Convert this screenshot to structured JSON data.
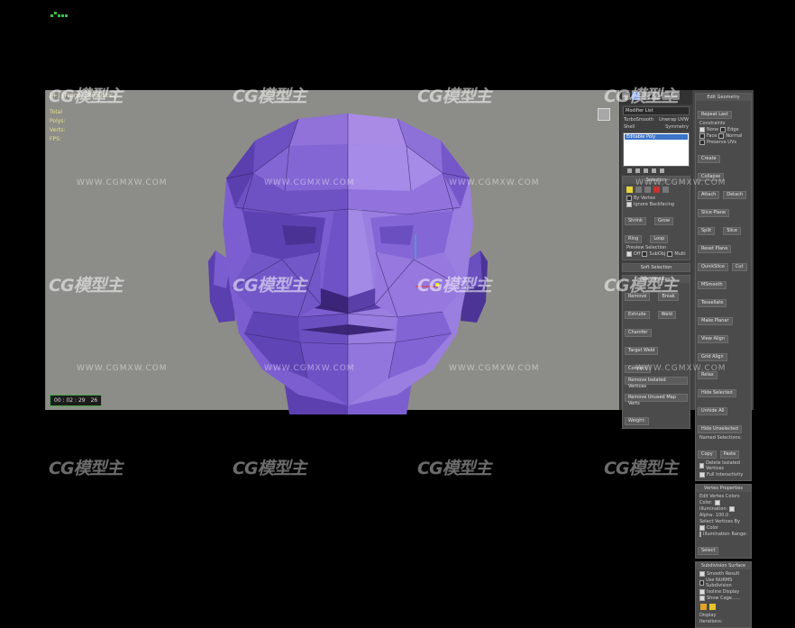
{
  "watermark": {
    "logo_text": "CG模型主",
    "url_text": "WWW.CGMXW.COM"
  },
  "viewport": {
    "label": "[+] [Front] [Realistic]",
    "stats": [
      "Total",
      "Polys:",
      "Verts:",
      "FPS:"
    ],
    "time": [
      "00 : 02 : 29",
      "26"
    ]
  },
  "panel": {
    "modifier_list": "Modifier List",
    "row1": [
      "TurboSmooth",
      "Unwrap UVW"
    ],
    "row2": [
      "Shell",
      "Symmetry"
    ],
    "stack_item": "Editable Poly",
    "selection": {
      "title": "Selection",
      "by_vertex": "By Vertex",
      "ignore_backfacing": "Ignore Backfacing",
      "shrink": "Shrink",
      "grow": "Grow",
      "ring": "Ring",
      "loop": "Loop",
      "preview_selection": "Preview Selection",
      "off": "Off",
      "subobj": "SubObj",
      "multi": "Multi"
    },
    "soft_selection": "Soft Selection",
    "edit_vertices": {
      "title": "Edit Vertices",
      "remove": "Remove",
      "break": "Break",
      "extrude": "Extrude",
      "weld": "Weld",
      "chamfer": "Chamfer",
      "target_weld": "Target Weld",
      "connect": "Connect",
      "remove_isolated": "Remove Isolated Vertices",
      "remove_unused": "Remove Unused Map Verts",
      "weight": "Weight:"
    },
    "edit_geometry": {
      "title": "Edit Geometry",
      "repeat_last": "Repeat Last",
      "constraints": "Constraints",
      "none": "None",
      "edge": "Edge",
      "face": "Face",
      "normal": "Normal",
      "preserve_uvs": "Preserve UVs",
      "create": "Create",
      "collapse": "Collapse",
      "attach": "Attach",
      "detach": "Detach",
      "slice_plane": "Slice Plane",
      "split": "Split",
      "slice": "Slice",
      "reset_plane": "Reset Plane",
      "quickslice": "QuickSlice",
      "cut": "Cut",
      "msmooth": "MSmooth",
      "tessellate": "Tessellate",
      "make_planar": "Make Planar",
      "view_align": "View Align",
      "grid_align": "Grid Align",
      "relax": "Relax",
      "hide_selected": "Hide Selected",
      "unhide_all": "Unhide All",
      "hide_unselected": "Hide Unselected",
      "named_selections": "Named Selections:",
      "copy": "Copy",
      "paste": "Paste",
      "delete_isolated": "Delete Isolated Vertices",
      "full_interactivity": "Full Interactivity"
    },
    "vertex_properties": {
      "title": "Vertex Properties",
      "edit_vertex_colors": "Edit Vertex Colors",
      "color": "Color:",
      "illumination": "Illumination:",
      "alpha": "Alpha:",
      "alpha_value": "100.0",
      "select_vertices_by": "Select Vertices By",
      "color_opt": "Color",
      "illumination_opt": "Illumination",
      "range": "Range:",
      "select": "Select"
    },
    "subdivision_surface": {
      "title": "Subdivision Surface",
      "smooth_result": "Smooth Result",
      "use_nurms": "Use NURMS Subdivision",
      "isoline_display": "Isoline Display",
      "show_cage": "Show Cage......",
      "display": "Display",
      "iterations": "Iterations:"
    }
  },
  "colors": {
    "mesh_light": "#a98be6",
    "mesh_mid": "#7f5fcf",
    "mesh_dark": "#4b3496",
    "viewport_bg": "#8c8d88",
    "accent_yellow": "#e6d43a",
    "accent_red": "#c8322c"
  }
}
